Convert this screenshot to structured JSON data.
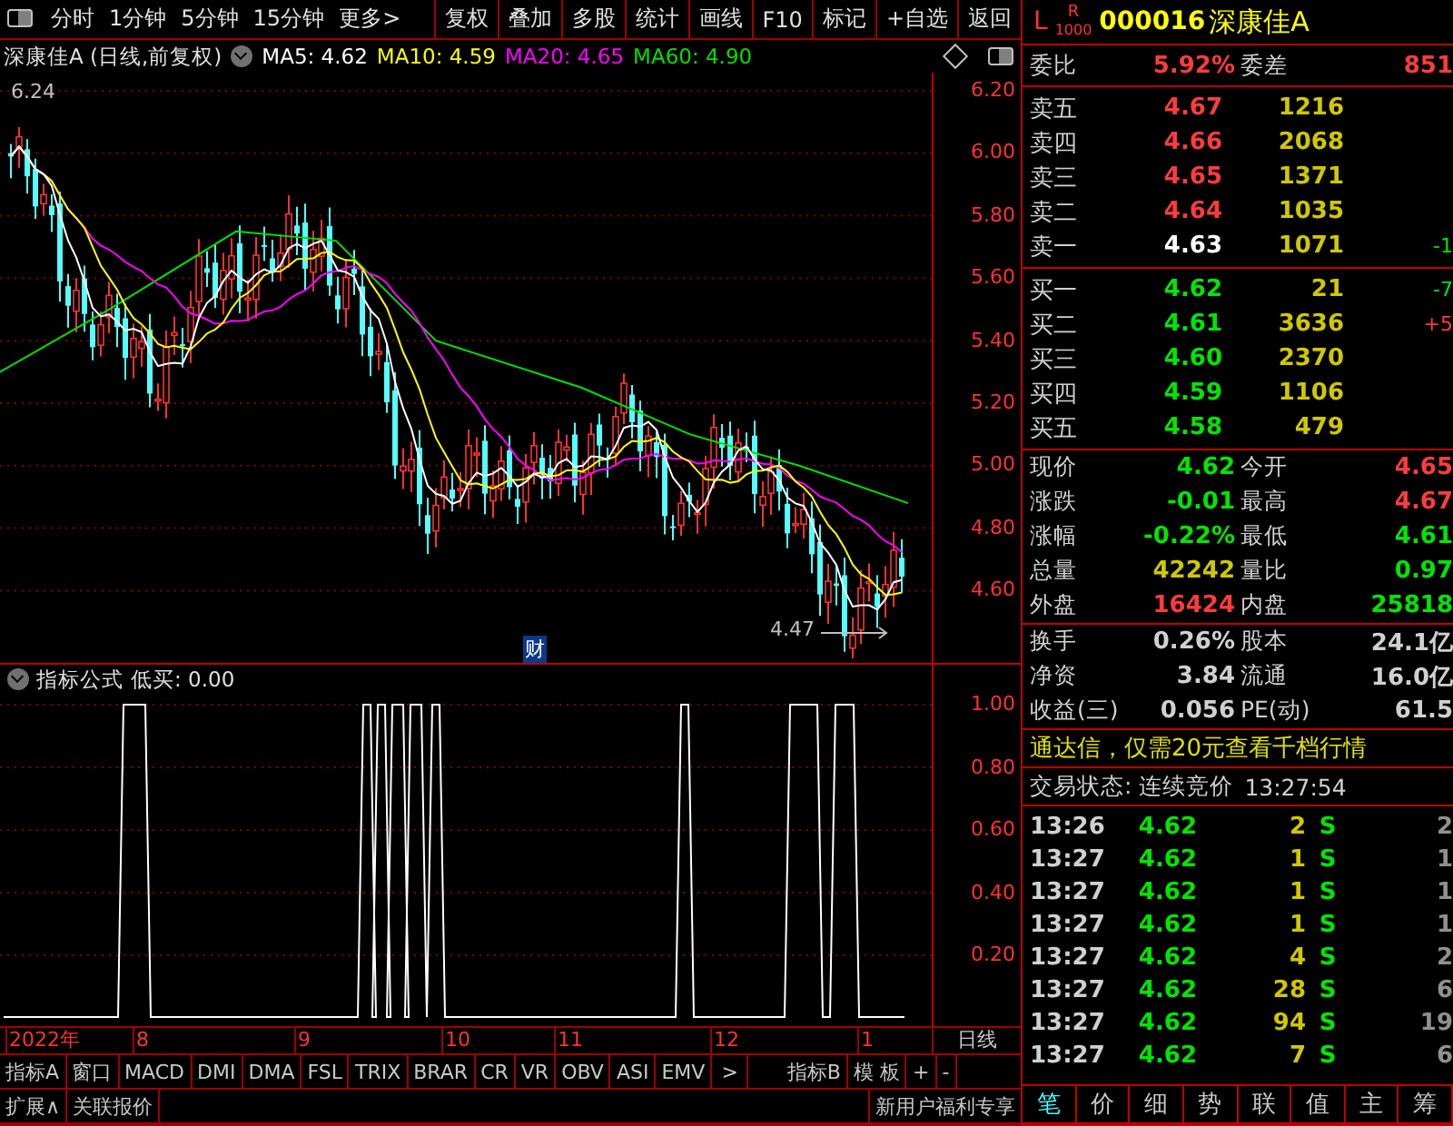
{
  "toolbar": {
    "period_tabs": [
      "分时",
      "1分钟",
      "5分钟",
      "15分钟",
      "更多>"
    ],
    "buttons": [
      "复权",
      "叠加",
      "多股",
      "统计",
      "画线",
      "F10",
      "标记",
      "+自选",
      "返回"
    ]
  },
  "chart_header": {
    "title": "深康佳A (日线,前复权)",
    "ma": [
      {
        "label": "MA5: 4.62",
        "color": "#ffffff"
      },
      {
        "label": "MA10: 4.59",
        "color": "#ffff00"
      },
      {
        "label": "MA20: 4.65",
        "color": "#ff00ff"
      },
      {
        "label": "MA60: 4.90",
        "color": "#00e000"
      }
    ]
  },
  "price_chart": {
    "high_marker": "6.24",
    "low_marker": "4.47",
    "event_marker": "财",
    "axis": [
      "6.20",
      "6.00",
      "5.80",
      "5.60",
      "5.40",
      "5.20",
      "5.00",
      "4.80",
      "4.60"
    ]
  },
  "indicator": {
    "title": "指标公式",
    "reading": "低买: 0.00",
    "axis": [
      "1.00",
      "0.80",
      "0.60",
      "0.40",
      "0.20"
    ]
  },
  "date_axis": {
    "labels": [
      "2022年",
      "8",
      "9",
      "10",
      "11",
      "12",
      "1"
    ],
    "period": "日线"
  },
  "indicator_tabs": [
    "指标A",
    "窗口",
    "MACD",
    "DMI",
    "DMA",
    "FSL",
    "TRIX",
    "BRAR",
    "CR",
    "VR",
    "OBV",
    "ASI",
    "EMV",
    ">",
    "指标B",
    "模 板",
    "+",
    "-"
  ],
  "bottom_bar": {
    "buttons": [
      "扩展∧",
      "关联报价"
    ],
    "promo": "新用户福利专享"
  },
  "quote": {
    "badge_l": "L",
    "badge_r": "R",
    "badge_lot": "1000",
    "code": "000016",
    "name": "深康佳A",
    "ratio": {
      "label": "委比",
      "value": "5.92%",
      "label2": "委差",
      "value2": "851"
    },
    "sell": [
      {
        "label": "卖五",
        "price": "4.67",
        "color": "#ff3c3c",
        "volume": "1216"
      },
      {
        "label": "卖四",
        "price": "4.66",
        "color": "#ff3c3c",
        "volume": "2068"
      },
      {
        "label": "卖三",
        "price": "4.65",
        "color": "#ff3c3c",
        "volume": "1371"
      },
      {
        "label": "卖二",
        "price": "4.64",
        "color": "#ff3c3c",
        "volume": "1035"
      },
      {
        "label": "卖一",
        "price": "4.63",
        "color": "#ffffff",
        "volume": "1071",
        "change": {
          "text": "-1",
          "color": "#00e600"
        }
      }
    ],
    "buy": [
      {
        "label": "买一",
        "price": "4.62",
        "color": "#00e600",
        "volume": "21",
        "change": {
          "text": "-7",
          "color": "#00e600"
        }
      },
      {
        "label": "买二",
        "price": "4.61",
        "color": "#00e600",
        "volume": "3636",
        "change": {
          "text": "+5",
          "color": "#ff3c3c"
        }
      },
      {
        "label": "买三",
        "price": "4.60",
        "color": "#00e600",
        "volume": "2370"
      },
      {
        "label": "买四",
        "price": "4.59",
        "color": "#00e600",
        "volume": "1106"
      },
      {
        "label": "买五",
        "price": "4.58",
        "color": "#00e600",
        "volume": "479"
      }
    ],
    "stats": [
      [
        {
          "label": "现价",
          "value": "4.62",
          "color": "#00e600"
        },
        {
          "label": "今开",
          "value": "4.65",
          "color": "#ff3c3c"
        }
      ],
      [
        {
          "label": "涨跌",
          "value": "-0.01",
          "color": "#00e600"
        },
        {
          "label": "最高",
          "value": "4.67",
          "color": "#ff3c3c"
        }
      ],
      [
        {
          "label": "涨幅",
          "value": "-0.22%",
          "color": "#00e600"
        },
        {
          "label": "最低",
          "value": "4.61",
          "color": "#00e600"
        }
      ],
      [
        {
          "label": "总量",
          "value": "42242",
          "color": "#d0c800"
        },
        {
          "label": "量比",
          "value": "0.97",
          "color": "#00e600"
        }
      ],
      [
        {
          "label": "外盘",
          "value": "16424",
          "color": "#ff3c3c"
        },
        {
          "label": "内盘",
          "value": "25818",
          "color": "#00e600"
        }
      ]
    ],
    "fundamentals": [
      {
        "label": "换手",
        "value": "0.26%",
        "label2": "股本",
        "value2": "24.1亿"
      },
      {
        "label": "净资",
        "value": "3.84",
        "label2": "流通",
        "value2": "16.0亿"
      },
      {
        "label": "收益(三)",
        "value": "0.056",
        "label2": "PE(动)",
        "value2": "61.5"
      }
    ],
    "ad": "通达信，仅需20元查看千档行情",
    "status": "交易状态: 连续竞价",
    "status_time": "13:27:54",
    "ticks": [
      {
        "time": "13:26",
        "price": "4.62",
        "volume": "2",
        "side": "S",
        "count": "2"
      },
      {
        "time": "13:27",
        "price": "4.62",
        "volume": "1",
        "side": "S",
        "count": "1"
      },
      {
        "time": "13:27",
        "price": "4.62",
        "volume": "1",
        "side": "S",
        "count": "1"
      },
      {
        "time": "13:27",
        "price": "4.62",
        "volume": "1",
        "side": "S",
        "count": "1"
      },
      {
        "time": "13:27",
        "price": "4.62",
        "volume": "4",
        "side": "S",
        "count": "2"
      },
      {
        "time": "13:27",
        "price": "4.62",
        "volume": "28",
        "side": "S",
        "count": "6"
      },
      {
        "time": "13:27",
        "price": "4.62",
        "volume": "94",
        "side": "S",
        "count": "19"
      },
      {
        "time": "13:27",
        "price": "4.62",
        "volume": "7",
        "side": "S",
        "count": "6"
      }
    ],
    "tabs": [
      {
        "label": "笔",
        "selected": true
      },
      {
        "label": "价",
        "selected": false
      },
      {
        "label": "细",
        "selected": false
      },
      {
        "label": "势",
        "selected": false
      },
      {
        "label": "联",
        "selected": false
      },
      {
        "label": "值",
        "selected": false
      },
      {
        "label": "主",
        "selected": false
      },
      {
        "label": "筹",
        "selected": false
      }
    ]
  }
}
